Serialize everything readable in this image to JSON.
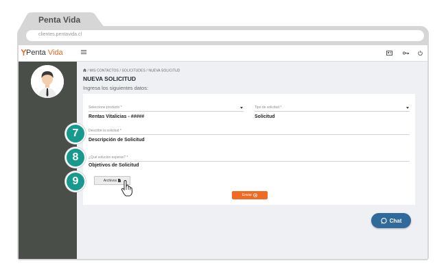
{
  "browser": {
    "tab_title": "Penta Vida",
    "url": "clientes.pentavida.cl"
  },
  "header": {
    "logo_part1": "Penta",
    "logo_part2": "Vida",
    "brand_color": "#e8661f",
    "icons": [
      "menu-icon",
      "id-card-icon",
      "key-icon",
      "power-icon"
    ]
  },
  "breadcrumb": "/ MIS CONTACTOS / SOLICITUDES / NUEVA SOLICITUD",
  "page_title": "NUEVA SOLICITUD",
  "subtitle": "Ingresa los siguientes datos:",
  "form": {
    "product_label": "Seleccione producto *",
    "product_value": "Rentas Vitalicias - #####",
    "type_label": "Tipo de solicitud *",
    "type_value": "Solicitud",
    "description_label": "Describe la solicitud *",
    "description_value": "Descripción de Solicitud",
    "solution_label": "¿Qué solución esperas? *",
    "solution_value": "Objetivos de Solicitud",
    "files_label": "Archivos",
    "send_label": "Enviar"
  },
  "steps": [
    "7",
    "8",
    "9"
  ],
  "chat_label": "Chat",
  "colors": {
    "step_circle": "#17998d",
    "sidebar": "#4a4e49",
    "send_button": "#f06a24",
    "chat_button": "#2f6a9b"
  }
}
